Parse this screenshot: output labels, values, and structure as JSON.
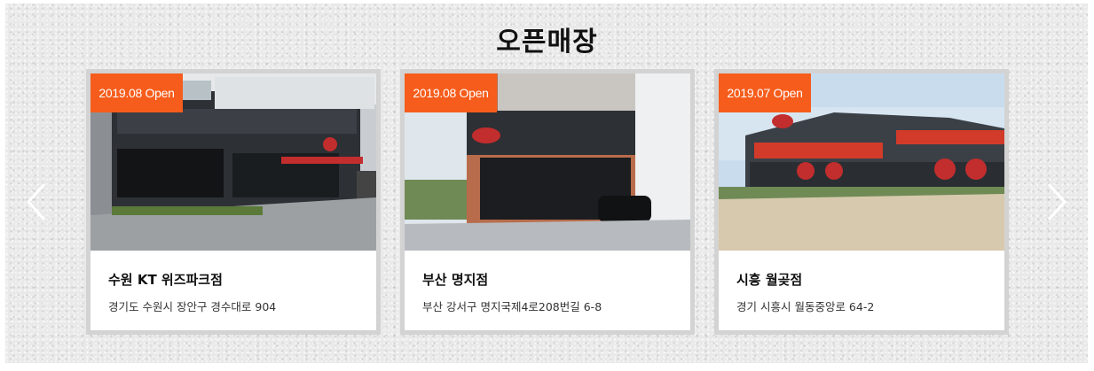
{
  "section": {
    "title": "오픈매장"
  },
  "carousel": {
    "prev_icon": "chevron-left-icon",
    "next_icon": "chevron-right-icon",
    "cards": [
      {
        "badge": "2019.08 Open",
        "name": "수원 KT 위즈파크점",
        "address": "경기도 수원시 장안구 경수대로 904",
        "photo": "store-front-photo"
      },
      {
        "badge": "2019.08 Open",
        "name": "부산 명지점",
        "address": "부산 강서구 명지국제4로208번길 6-8",
        "photo": "store-front-photo"
      },
      {
        "badge": "2019.07 Open",
        "name": "시흥 월곶점",
        "address": "경기 시흥시 월동중앙로 64-2",
        "photo": "store-front-photo"
      }
    ]
  },
  "colors": {
    "badge": "#f65c1b",
    "card_border": "#d3d3d3",
    "background": "#e9e9e9"
  }
}
